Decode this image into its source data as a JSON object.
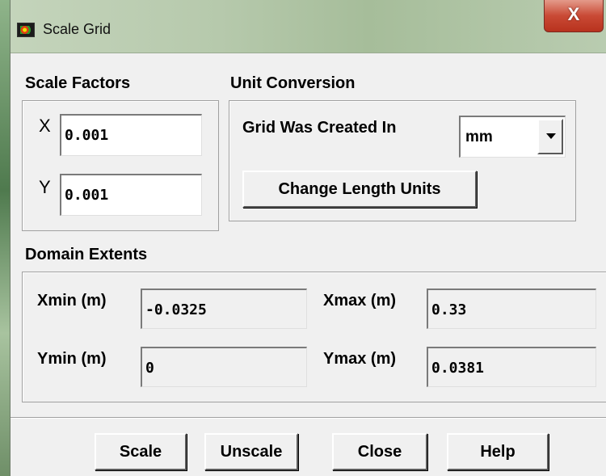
{
  "window": {
    "title": "Scale Grid",
    "close_glyph": "X"
  },
  "scale_factors": {
    "label": "Scale Factors",
    "x_label": "X",
    "x_value": "0.001",
    "y_label": "Y",
    "y_value": "0.001"
  },
  "unit_conversion": {
    "label": "Unit Conversion",
    "grid_created_label": "Grid Was Created In",
    "grid_unit": "mm",
    "change_units_label": "Change Length Units"
  },
  "domain_extents": {
    "label": "Domain Extents",
    "xmin_label": "Xmin (m)",
    "xmin_value": "-0.0325",
    "xmax_label": "Xmax (m)",
    "xmax_value": "0.33",
    "ymin_label": "Ymin (m)",
    "ymin_value": "0",
    "ymax_label": "Ymax (m)",
    "ymax_value": "0.0381"
  },
  "buttons": {
    "scale": "Scale",
    "unscale": "Unscale",
    "close": "Close",
    "help": "Help"
  }
}
